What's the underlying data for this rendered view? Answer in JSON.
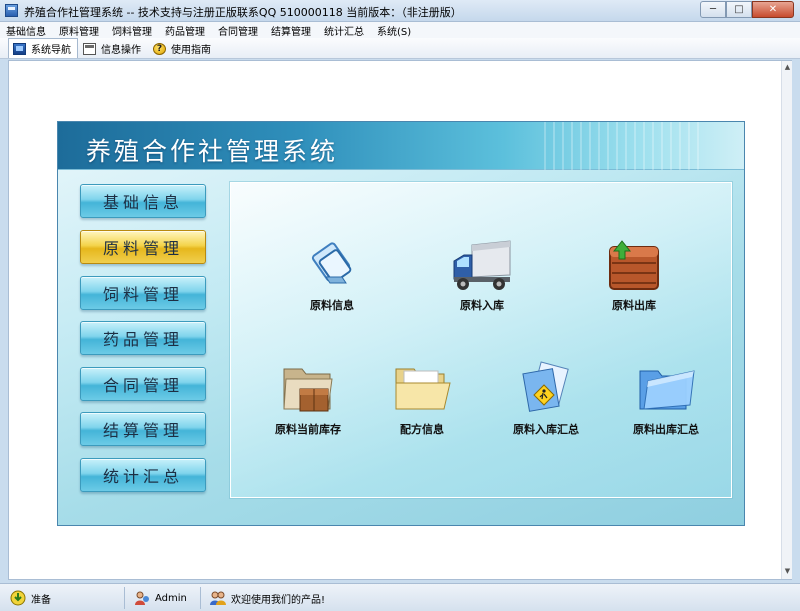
{
  "window": {
    "title": "养殖合作社管理系统 -- 技术支持与注册正版联系QQ 510000118    当前版本：（非注册版）",
    "min_glyph": "─",
    "max_glyph": "□",
    "close_glyph": "✕"
  },
  "menu": {
    "items": [
      "基础信息",
      "原料管理",
      "饲料管理",
      "药品管理",
      "合同管理",
      "结算管理",
      "统计汇总",
      "系统(S)"
    ]
  },
  "toolbar": {
    "tabs": [
      {
        "label": "系统导航",
        "icon": "nav-window-icon",
        "active": true
      },
      {
        "label": "信息操作",
        "icon": "info-doc-icon",
        "active": false
      },
      {
        "label": "使用指南",
        "icon": "help-icon",
        "active": false
      }
    ]
  },
  "panel": {
    "title": "养殖合作社管理系统",
    "side_buttons": [
      {
        "label": "基础信息",
        "selected": false
      },
      {
        "label": "原料管理",
        "selected": true
      },
      {
        "label": "饲料管理",
        "selected": false
      },
      {
        "label": "药品管理",
        "selected": false
      },
      {
        "label": "合同管理",
        "selected": false
      },
      {
        "label": "结算管理",
        "selected": false
      },
      {
        "label": "统计汇总",
        "selected": false
      }
    ],
    "functions": [
      {
        "label": "原料信息",
        "icon": "material-info-icon"
      },
      {
        "label": "原料入库",
        "icon": "delivery-truck-icon"
      },
      {
        "label": "原料出库",
        "icon": "crate-export-icon"
      },
      {
        "label": "原料当前库存",
        "icon": "folder-box-icon"
      },
      {
        "label": "配方信息",
        "icon": "open-folder-icon"
      },
      {
        "label": "原料入库汇总",
        "icon": "document-person-icon"
      },
      {
        "label": "原料出库汇总",
        "icon": "blue-folder-icon"
      }
    ]
  },
  "status": {
    "ready": "准备",
    "user": "Admin",
    "message": "欢迎使用我们的产品!"
  },
  "colors": {
    "header_dark": "#1d6c9a",
    "button_cyan": "#44b4d8",
    "button_selected": "#e6b71c"
  }
}
